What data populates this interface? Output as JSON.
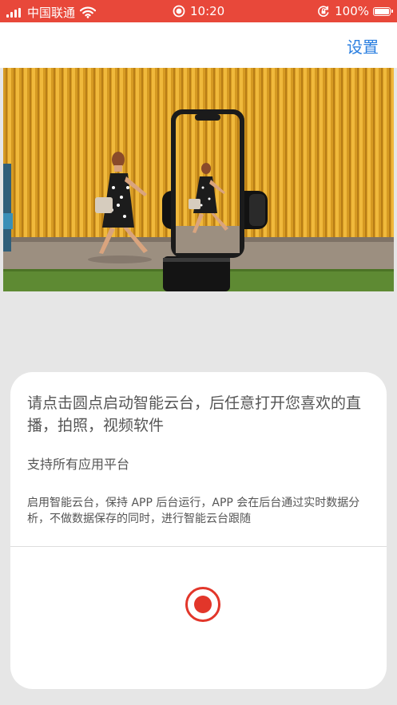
{
  "status_bar": {
    "carrier": "中国联通",
    "time": "10:20",
    "battery": "100%",
    "icons": [
      "signal-icon",
      "wifi-icon",
      "location-icon",
      "orientation-lock-icon",
      "battery-icon"
    ]
  },
  "nav": {
    "settings_label": "设置"
  },
  "card": {
    "headline": "请点击圆点启动智能云台，后任意打开您喜欢的直播，拍照，视频软件",
    "subheadline": "支持所有应用平台",
    "description": "启用智能云台，保持 APP 后台运行，APP 会在后台通过实时数据分析，不做数据保存的同时，进行智能云台跟随",
    "record_button_icon": "record-icon"
  },
  "colors": {
    "status_bar": "#e8483a",
    "accent_blue": "#2b7fe0",
    "record_red": "#e2362a",
    "page_background": "#e6e6e6",
    "card_background": "#ffffff",
    "body_text": "#555555"
  }
}
